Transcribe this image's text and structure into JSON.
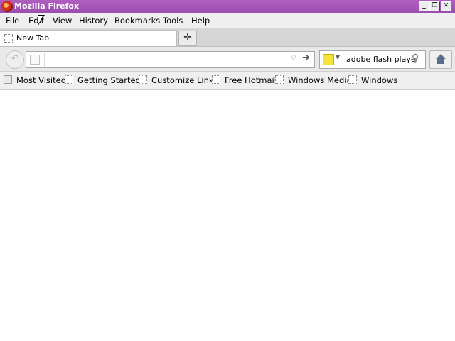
{
  "window": {
    "title": "Mozilla Firefox",
    "controls": [
      "minimize",
      "restore",
      "close"
    ]
  },
  "menubar": {
    "items": [
      "File",
      "Edit",
      "View",
      "History",
      "Bookmarks",
      "Tools",
      "Help"
    ]
  },
  "tabs": {
    "items": [
      {
        "label": "New Tab",
        "active": true
      }
    ],
    "new_tab_icon": "plus-icon"
  },
  "navbar": {
    "back_icon": "back-arrow-icon",
    "url": {
      "value": "",
      "placeholder": ""
    },
    "go_icon": "go-arrow-icon",
    "search": {
      "engine_icon": "search-engine-icon",
      "value": "adobe flash player"
    },
    "home_icon": "home-icon"
  },
  "bookmarks": {
    "items": [
      "Most Visited",
      "Getting Started",
      "Customize Links",
      "Free Hotmail",
      "Windows Media",
      "Windows"
    ]
  }
}
